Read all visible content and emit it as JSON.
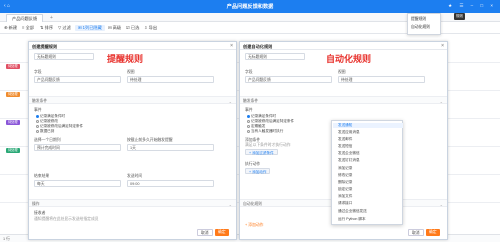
{
  "titlebar": {
    "back": "‹ ⌂",
    "title": "产品问题反馈和数据",
    "right_icons": "★ ☰ – □ ×"
  },
  "tab": {
    "label": "产品问题反馈",
    "plus": "+"
  },
  "toolbar": {
    "items": [
      "⊕ 新建",
      "≡ 全部",
      "⇅ 排序",
      "▽ 过滤",
      "⊞ 1列已隐藏",
      "⊟ 高级",
      "☑ 已选",
      "⇩ 导出"
    ]
  },
  "grid_chips": [
    {
      "label": "待处理",
      "color": "#e04f63"
    },
    {
      "label": "待处理",
      "color": "#f08c2e"
    },
    {
      "label": "待处理",
      "color": "#8a56d8"
    },
    {
      "label": "待处理",
      "color": "#2aa876"
    }
  ],
  "dropdown": {
    "items": [
      "提醒规则",
      "自动化规则"
    ],
    "tooltip": "规则"
  },
  "left_panel": {
    "header": "创建提醒规则",
    "name_value": "无标题规则",
    "red_label": "提醒规则",
    "field_label": "字段",
    "field_value": "产品问题反馈",
    "view_label": "视图",
    "view_value": "待处理",
    "sec_trigger": "触发条件",
    "event_label": "事件",
    "radios": [
      "记录满足条件时",
      "记录被修改",
      "记录被修改后满足特定条件",
      "数据已到"
    ],
    "choose_label": "选择一个日期列",
    "choose_value": "预计完成时间",
    "time_label": "按截止前多久开始触发提醒",
    "time_value": "1天",
    "freq_label": "结束结果",
    "freq_value": "每天",
    "time2_label": "发送时间",
    "time2_value": "09:00",
    "sec_action": "操作",
    "receiver_label": "接收者",
    "receiver_hint": "通知提醒将在此处显示发送给指定成员",
    "cancel": "取消",
    "confirm": "确定"
  },
  "right_panel": {
    "header": "创建自动化规则",
    "name_value": "无标题规则",
    "red_label": "自动化规则",
    "field_label": "字段",
    "field_value": "产品问题反馈",
    "view_label": "视图",
    "view_value": "待处理",
    "sec_trigger": "触发条件",
    "event_label": "事件",
    "radios": [
      "记录满足条件时",
      "记录被修改后满足特定条件",
      "定期触发",
      "当有人触发器时执行"
    ],
    "cond_label": "添加条件",
    "cond_hint": "满足以下条件时才执行动作",
    "add_cond": "+ 添加过滤条件",
    "add_action_label": "执行动作",
    "add_action_btn": "+ 添加动作",
    "sec_action": "自动化规则",
    "footnote": "+ 添加动作",
    "cancel": "取消",
    "confirm": "确定"
  },
  "menu": {
    "items": [
      "发送通知",
      "发送应用消息",
      "发送邮件",
      "发送短信",
      "发送企业微信",
      "发送钉钉消息",
      "添加记录",
      "修改记录",
      "删除记录",
      "锁定记录",
      "添加文件",
      "请求接口",
      "通过企业微信发送",
      "运行 Python 脚本"
    ]
  },
  "status": {
    "text": "1 行"
  }
}
